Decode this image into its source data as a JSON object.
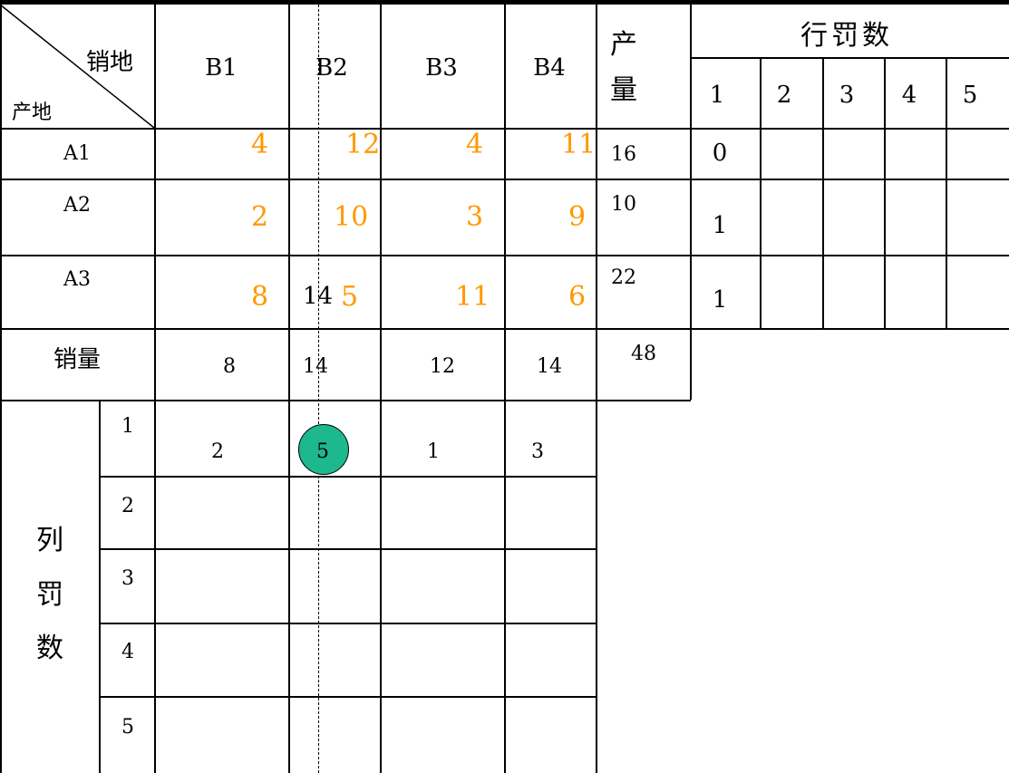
{
  "header": {
    "corner_top": "销地",
    "corner_bottom": "产地",
    "cols": [
      "B1",
      "B2",
      "B3",
      "B4"
    ],
    "production_1": "产",
    "production_2": "量",
    "row_penalty": "行罚数",
    "row_penalty_nums": [
      "1",
      "2",
      "3",
      "4",
      "5"
    ]
  },
  "rows": [
    {
      "label": "A1",
      "costs": [
        "4",
        "12",
        "4",
        "11"
      ],
      "production": "16",
      "penalty1": "0"
    },
    {
      "label": "A2",
      "costs": [
        "2",
        "10",
        "3",
        "9"
      ],
      "production": "10",
      "penalty1": "1"
    },
    {
      "label": "A3",
      "costs": [
        "8",
        "5",
        "11",
        "6"
      ],
      "production": "22",
      "penalty1": "1",
      "alloc_b2": "14"
    }
  ],
  "sales": {
    "label": "销量",
    "values": [
      "8",
      "14",
      "12",
      "14"
    ],
    "total": "48"
  },
  "col_penalty": {
    "label_chars": [
      "列",
      "罚",
      "数"
    ],
    "nums": [
      "1",
      "2",
      "3",
      "4",
      "5"
    ],
    "round1": [
      "2",
      "5",
      "1",
      "3"
    ]
  },
  "colors": {
    "cost": "#FF9900",
    "highlight": "#1DB88E"
  }
}
